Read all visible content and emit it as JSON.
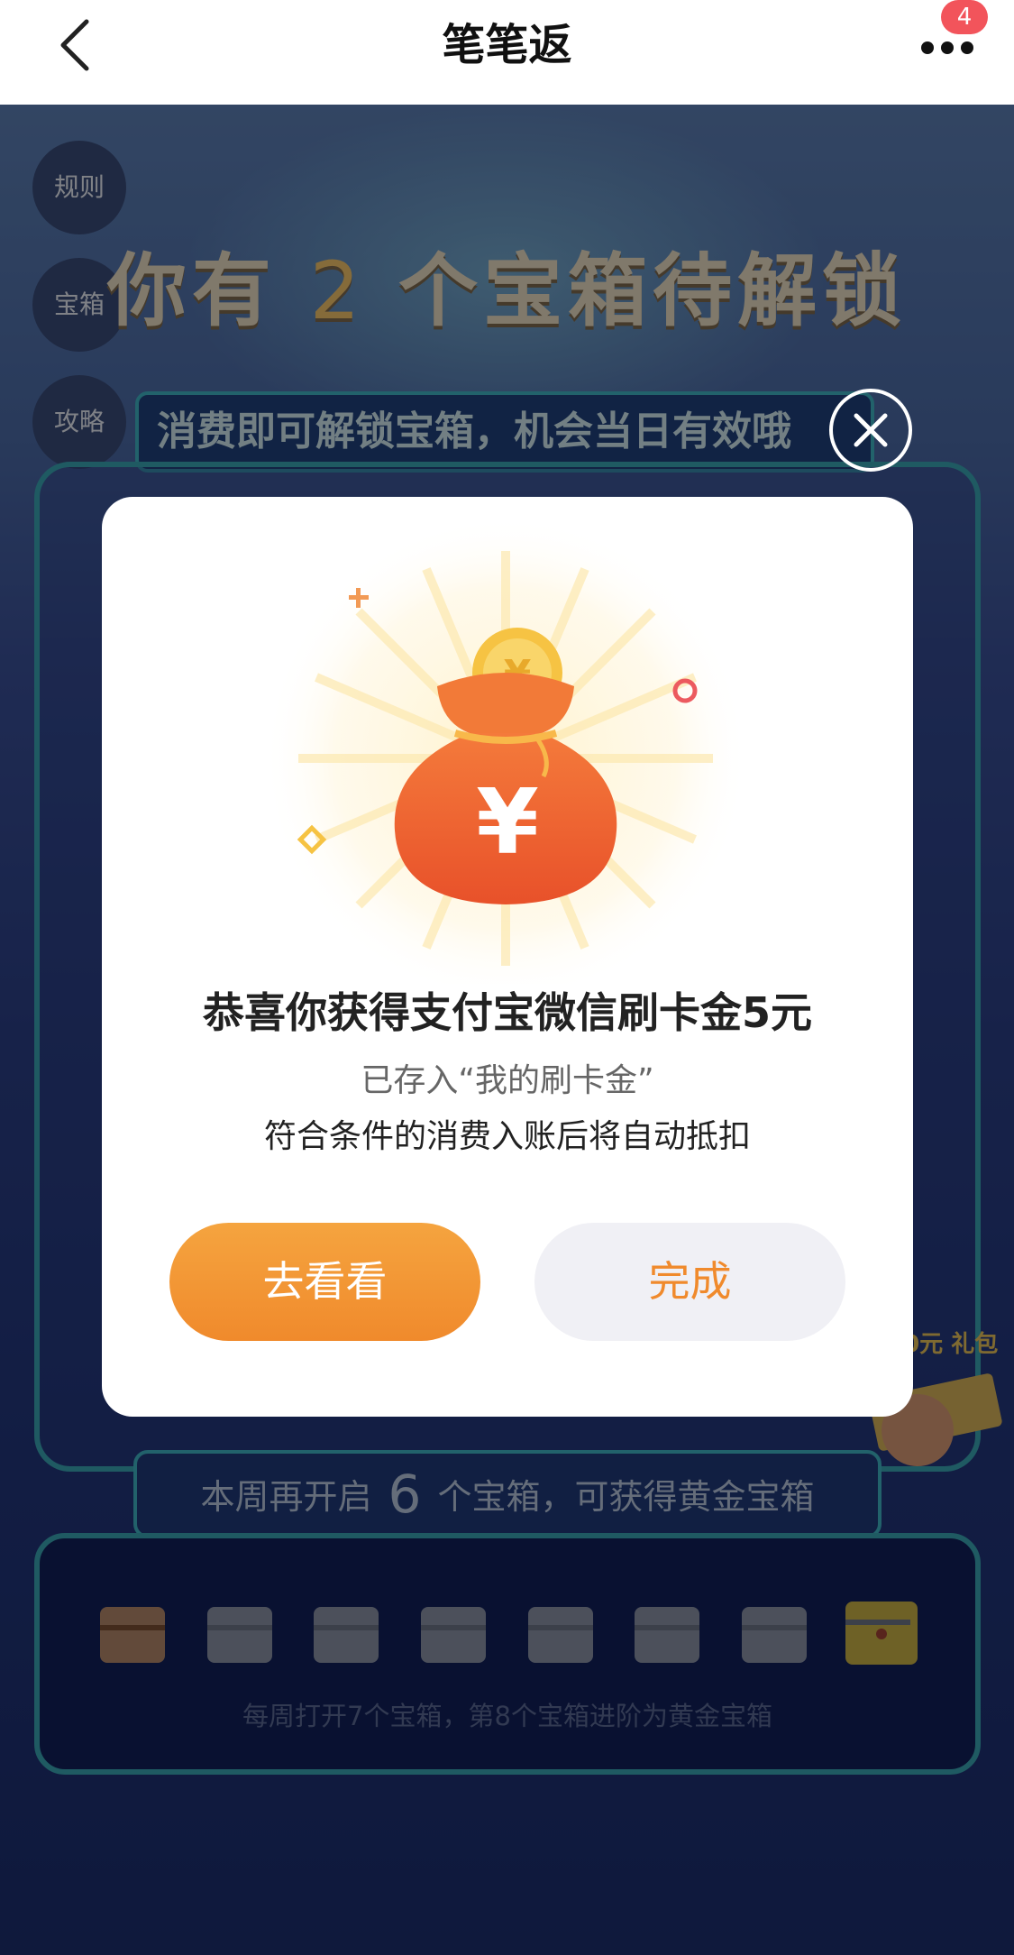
{
  "nav": {
    "title": "笔笔返",
    "badge_count": "4",
    "back_icon": "chevron-left-icon",
    "more_icon": "more-dots-icon"
  },
  "page": {
    "side_buttons": [
      "规则",
      "宝箱",
      "攻略"
    ],
    "headline_pre": "你有",
    "headline_num": "2",
    "headline_post": "个宝箱待解锁",
    "banner": "消费即可解锁宝箱，机会当日有效哦",
    "promo_text": "周60元 礼包",
    "progress_pre": "本周再开启",
    "progress_num": "6",
    "progress_post": "个宝箱，可获得黄金宝箱",
    "chest_caption": "每周打开7个宝箱，第8个宝箱进阶为黄金宝箱",
    "chests": [
      {
        "state": "opened"
      },
      {
        "state": "locked"
      },
      {
        "state": "locked"
      },
      {
        "state": "locked"
      },
      {
        "state": "locked"
      },
      {
        "state": "locked"
      },
      {
        "state": "locked"
      },
      {
        "state": "gold"
      }
    ]
  },
  "modal": {
    "title": "恭喜你获得支付宝微信刷卡金5元",
    "subtitle": "已存入“我的刷卡金”",
    "note": "符合条件的消费入账后将自动抵扣",
    "primary_button": "去看看",
    "secondary_button": "完成",
    "close_icon": "close-circle-icon",
    "illustration_icon": "money-bag-icon"
  },
  "colors": {
    "accent_orange": "#f08a2c",
    "badge_red": "#f2545b",
    "panel_border": "#3aa4b2"
  }
}
